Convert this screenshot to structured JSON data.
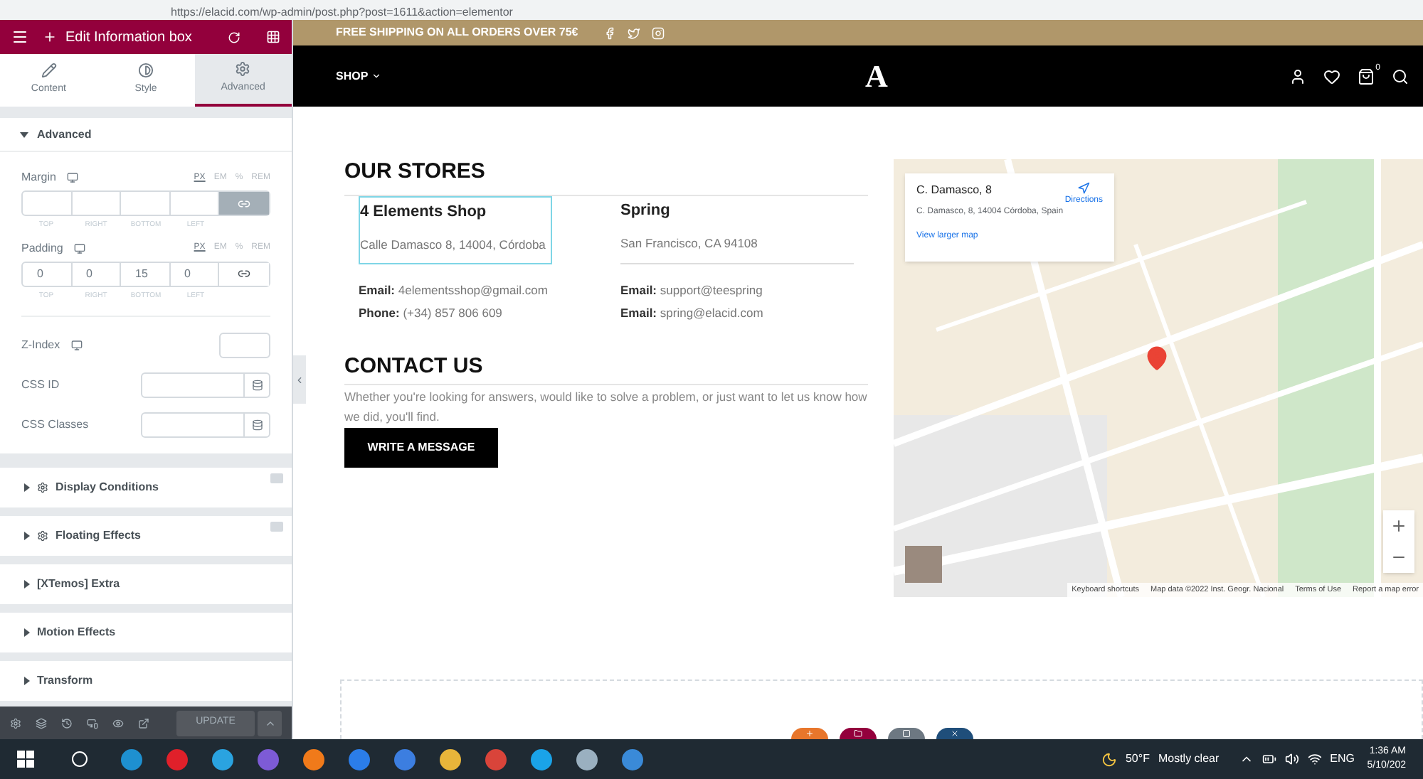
{
  "browser": {
    "url": "https://elacid.com/wp-admin/post.php?post=1611&action=elementor"
  },
  "editor": {
    "title": "Edit Information box",
    "tabs": [
      {
        "label": "Content",
        "kind": "pencil",
        "selected": false
      },
      {
        "label": "Style",
        "kind": "contrast",
        "selected": false
      },
      {
        "label": "Advanced",
        "kind": "gear",
        "selected": true
      }
    ],
    "section_title": "Advanced",
    "section_expanded": true,
    "margin": {
      "label": "Margin",
      "linked": true,
      "units": [
        {
          "label": "PX",
          "selected": true
        },
        {
          "label": "EM",
          "selected": false
        },
        {
          "label": "%",
          "selected": false
        },
        {
          "label": "REM",
          "selected": false
        }
      ],
      "fields": [
        {
          "caption": "TOP"
        },
        {
          "caption": "RIGHT"
        },
        {
          "caption": "BOTTOM"
        },
        {
          "caption": "LEFT"
        }
      ]
    },
    "padding": {
      "label": "Padding",
      "linked": false,
      "units": [
        {
          "label": "PX",
          "selected": true
        },
        {
          "label": "EM",
          "selected": false
        },
        {
          "label": "%",
          "selected": false
        },
        {
          "label": "REM",
          "selected": false
        }
      ],
      "fields": [
        {
          "value": "0",
          "caption": "TOP"
        },
        {
          "value": "0",
          "caption": "RIGHT"
        },
        {
          "value": "15",
          "caption": "BOTTOM"
        },
        {
          "value": "0",
          "caption": "LEFT"
        }
      ]
    },
    "z_index": {
      "label": "Z-Index"
    },
    "css_id": {
      "label": "CSS ID"
    },
    "css_classes": {
      "label": "CSS Classes"
    },
    "sections": [
      {
        "title": "Display Conditions",
        "kind": "addon",
        "expanded": false
      },
      {
        "title": "Floating Effects",
        "kind": "addon",
        "expanded": false
      },
      {
        "title": "[XTemos] Extra",
        "kind": "plain",
        "expanded": false
      },
      {
        "title": "Motion Effects",
        "kind": "plain",
        "expanded": false
      },
      {
        "title": "Transform",
        "kind": "plain",
        "expanded": false
      }
    ],
    "update_label": "UPDATE"
  },
  "site": {
    "promo": "FREE SHIPPING ON ALL ORDERS OVER 75€",
    "menu": "SHOP",
    "logo": "A",
    "cart_count": "0",
    "stores_heading": "OUR STORES",
    "stores": [
      {
        "name": "4 Elements Shop",
        "address": "Calle Damasco 8, 14004, Córdoba",
        "selected": true,
        "contacts": [
          {
            "label": "Email:",
            "value": "4elementsshop@gmail.com"
          },
          {
            "label": "Phone:",
            "value": "(+34) 857 806 609"
          }
        ]
      },
      {
        "name": "Spring",
        "address": "San Francisco, CA 94108",
        "selected": false,
        "contacts": [
          {
            "label": "Email:",
            "value": "support@teespring"
          },
          {
            "label": "Email:",
            "value": "spring@elacid.com"
          }
        ]
      }
    ],
    "contact_heading": "CONTACT US",
    "contact_text": "Whether you're looking for answers, would like to solve a problem, or just want to let us know how we did, you'll find.",
    "contact_button": "WRITE A MESSAGE",
    "map": {
      "place_title": "C. Damasco, 8",
      "place_address": "C. Damasco, 8, 14004 Córdoba, Spain",
      "directions": "Directions",
      "larger_map": "View larger map",
      "attribution": [
        "Keyboard shortcuts",
        "Map data ©2022 Inst. Geogr. Nacional",
        "Terms of Use",
        "Report a map error"
      ]
    },
    "add_buttons": [
      {
        "kind": "plus",
        "color": "#e8762b"
      },
      {
        "kind": "folder",
        "color": "#93003c"
      },
      {
        "kind": "template",
        "color": "#6d7882"
      },
      {
        "kind": "close",
        "color": "#1f4e7a"
      }
    ]
  },
  "taskbar": {
    "temperature": "50°F",
    "weather": "Mostly clear",
    "language": "ENG",
    "time": "1:36 AM",
    "date": "5/10/202"
  }
}
